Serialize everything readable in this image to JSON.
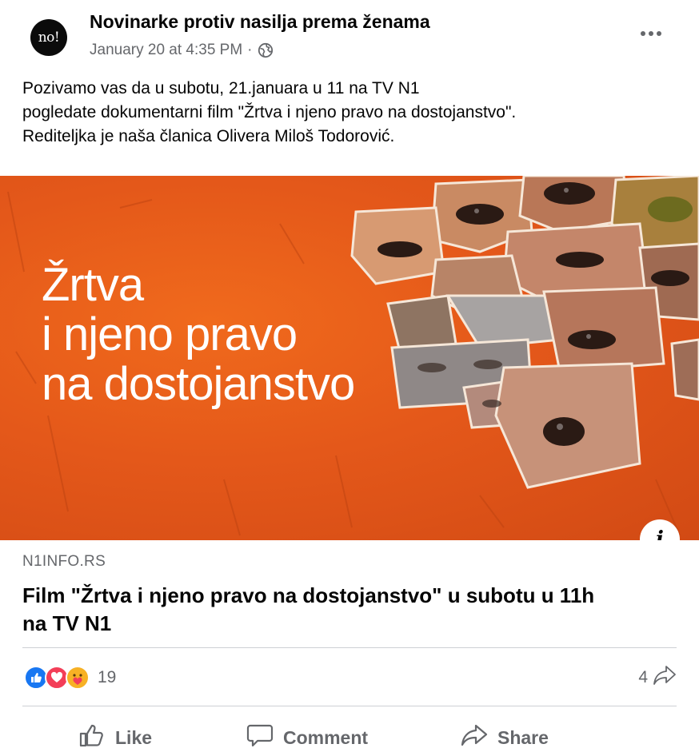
{
  "post": {
    "avatar_text": "no!",
    "page_name": "Novinarke protiv nasilja prema ženama",
    "timestamp": "January 20 at 4:35 PM",
    "separator": "·",
    "audience_icon": "globe-icon",
    "more_icon": "more-options-icon",
    "text_lines": [
      "Pozivamo vas da u subotu, 21.januara u 11 na TV N1",
      "pogledate dokumentarni film \"Žrtva i njeno pravo na dostojanstvo\".",
      "Rediteljka je naša članica Olivera Miloš Todorović."
    ]
  },
  "link_preview": {
    "image_title_lines": [
      "Žrtva",
      "i njeno pravo",
      "na dostojanstvo"
    ],
    "info_label": "i",
    "domain": "N1INFO.RS",
    "title_lines": [
      "Film \"Žrtva i njeno pravo na dostojanstvo\" u subotu u 11h",
      "na TV N1"
    ]
  },
  "engagement": {
    "reaction_icons": [
      "like-reaction-icon",
      "love-reaction-icon",
      "care-reaction-icon"
    ],
    "reaction_count": "19",
    "share_count": "4",
    "share_count_icon": "share-arrow-icon"
  },
  "actions": {
    "like_label": "Like",
    "comment_label": "Comment",
    "share_label": "Share"
  },
  "colors": {
    "image_background": "#e4581a",
    "secondary_text": "#65676b",
    "like_blue": "#1877f2",
    "love_red": "#f33e58",
    "care_yellow": "#f7b125"
  }
}
